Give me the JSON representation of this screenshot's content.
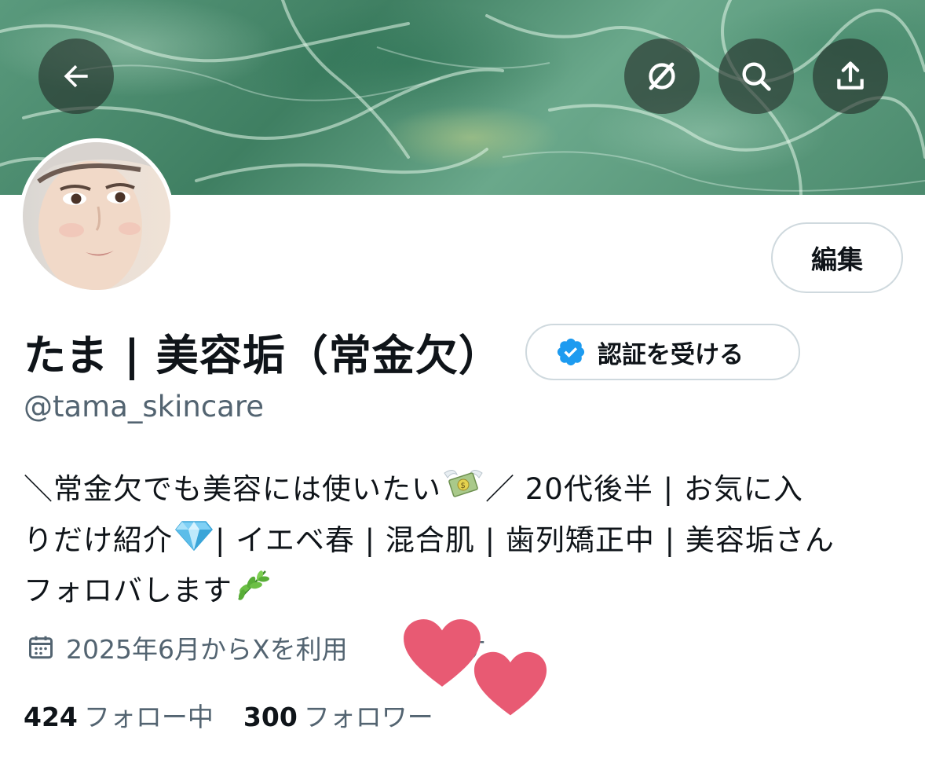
{
  "header": {
    "back_icon": "arrow-left-icon",
    "grok_icon": "grok-icon",
    "search_icon": "search-icon",
    "share_icon": "share-icon"
  },
  "profile": {
    "display_name": "たま | 美容垢（常金欠）",
    "handle": "@tama_skincare",
    "edit_label": "編集",
    "verify_label": "認証を受ける",
    "bio_lines": [
      "＼常金欠でも美容には使いたい",
      "／ 20代後半 | お気に入",
      "りだけ紹介",
      "| イエベ春 | 混合肌 | 歯列矯正中 | 美容垢さん",
      "フォロバします"
    ],
    "joined_text_before": "2025年6月からXを利用",
    "joined_text_after": "ます",
    "following_count": "424",
    "following_label": "フォロー中",
    "followers_count": "300",
    "followers_label": "フォロワー"
  },
  "colors": {
    "accent_verified": "#1d9bf0",
    "text_primary": "#0f1419",
    "text_secondary": "#536471",
    "border": "#cfd9de",
    "heart": "#e85a73"
  }
}
